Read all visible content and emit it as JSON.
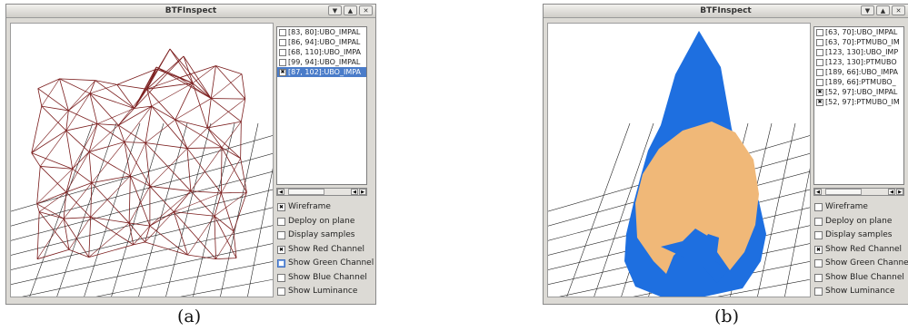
{
  "panels": [
    {
      "title": "BTFInspect",
      "buttons": [
        {
          "glyph": "▼",
          "icon": "minimize-icon"
        },
        {
          "glyph": "▲",
          "icon": "maximize-icon"
        },
        {
          "glyph": "✕",
          "icon": "close-icon"
        }
      ],
      "list": [
        {
          "label": "[83, 80]:UBO_IMPAL",
          "checked": false,
          "selected": false
        },
        {
          "label": "[86, 94]:UBO_IMPAL",
          "checked": false,
          "selected": false
        },
        {
          "label": "[68, 110]:UBO_IMPA",
          "checked": false,
          "selected": false
        },
        {
          "label": "[99, 94]:UBO_IMPAL",
          "checked": false,
          "selected": false
        },
        {
          "label": "[87, 102]:UBO_IMPA",
          "checked": true,
          "selected": true
        }
      ],
      "options": [
        {
          "label": "Wireframe",
          "checked": true
        },
        {
          "label": "Deploy on plane",
          "checked": false
        },
        {
          "label": "Display samples",
          "checked": false
        },
        {
          "label": "Show Red Channel",
          "checked": true
        },
        {
          "label": "Show Green Channel",
          "checked": false,
          "focused": true
        },
        {
          "label": "Show Blue Channel",
          "checked": false
        },
        {
          "label": "Show Luminance",
          "checked": false
        }
      ],
      "caption": "(a)"
    },
    {
      "title": "BTFInspect",
      "buttons": [
        {
          "glyph": "▼",
          "icon": "minimize-icon"
        },
        {
          "glyph": "▲",
          "icon": "maximize-icon"
        },
        {
          "glyph": "✕",
          "icon": "close-icon"
        }
      ],
      "list": [
        {
          "label": "[63, 70]:UBO_IMPAL",
          "checked": false,
          "selected": false
        },
        {
          "label": "[63, 70]:PTMUBO_IM",
          "checked": false,
          "selected": false
        },
        {
          "label": "[123, 130]:UBO_IMP",
          "checked": false,
          "selected": false
        },
        {
          "label": "[123, 130]:PTMUBO",
          "checked": false,
          "selected": false
        },
        {
          "label": "[189, 66]:UBO_IMPA",
          "checked": false,
          "selected": false
        },
        {
          "label": "[189, 66]:PTMUBO_",
          "checked": false,
          "selected": false
        },
        {
          "label": "[52, 97]:UBO_IMPAL",
          "checked": true,
          "selected": false
        },
        {
          "label": "[52, 97]:PTMUBO_IM",
          "checked": true,
          "selected": false
        }
      ],
      "options": [
        {
          "label": "Wireframe",
          "checked": false
        },
        {
          "label": "Deploy on plane",
          "checked": false
        },
        {
          "label": "Display samples",
          "checked": false
        },
        {
          "label": "Show Red Channel",
          "checked": true
        },
        {
          "label": "Show Green Channel",
          "checked": false
        },
        {
          "label": "Show Blue Channel",
          "checked": false
        },
        {
          "label": "Show Luminance",
          "checked": false
        }
      ],
      "caption": "(b)"
    }
  ],
  "colors": {
    "wireframe": "#7a1c1c",
    "grid": "#222222",
    "surface_blue": "#1e6fe0",
    "surface_tan": "#f0b878",
    "selection": "#4a7cc9"
  }
}
